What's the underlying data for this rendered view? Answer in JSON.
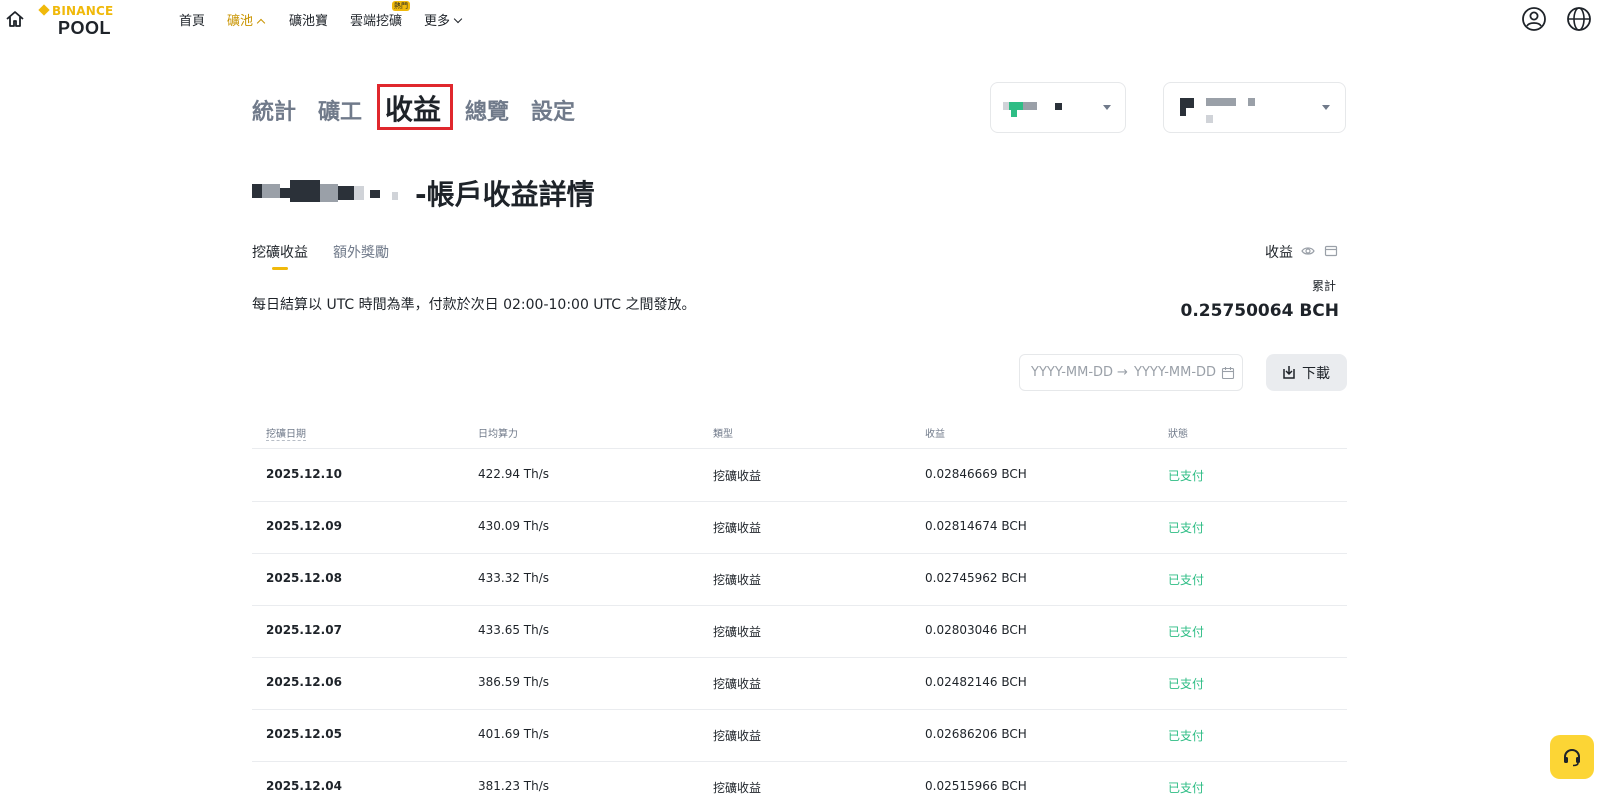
{
  "nav": {
    "logo_top": "BINANCE",
    "logo_bottom": "POOL",
    "items": [
      "首頁",
      "礦池",
      "礦池寶",
      "雲端挖礦",
      "更多"
    ],
    "hot_badge": "熱門"
  },
  "section_tabs": [
    "統計",
    "礦工",
    "收益",
    "總覽",
    "設定"
  ],
  "page_title_suffix": "-帳戶收益詳情",
  "sub_tabs": [
    "挖礦收益",
    "額外獎勵"
  ],
  "earnings": {
    "label": "收益",
    "cumulative_label": "累計",
    "cumulative_value": "0.25750064 BCH"
  },
  "note": "每日結算以 UTC 時間為準，付款於次日 02:00-10:00 UTC 之間發放。",
  "date_range": {
    "start_placeholder": "YYYY-MM-DD",
    "arrow": "→",
    "end_placeholder": "YYYY-MM-DD"
  },
  "download_label": "下載",
  "table": {
    "headers": [
      "挖礦日期",
      "日均算力",
      "類型",
      "收益",
      "狀態"
    ],
    "rows": [
      {
        "date": "2025.12.10",
        "hashrate": "422.94 Th/s",
        "type": "挖礦收益",
        "earnings": "0.02846669 BCH",
        "status": "已支付"
      },
      {
        "date": "2025.12.09",
        "hashrate": "430.09 Th/s",
        "type": "挖礦收益",
        "earnings": "0.02814674 BCH",
        "status": "已支付"
      },
      {
        "date": "2025.12.08",
        "hashrate": "433.32 Th/s",
        "type": "挖礦收益",
        "earnings": "0.02745962 BCH",
        "status": "已支付"
      },
      {
        "date": "2025.12.07",
        "hashrate": "433.65 Th/s",
        "type": "挖礦收益",
        "earnings": "0.02803046 BCH",
        "status": "已支付"
      },
      {
        "date": "2025.12.06",
        "hashrate": "386.59 Th/s",
        "type": "挖礦收益",
        "earnings": "0.02482146 BCH",
        "status": "已支付"
      },
      {
        "date": "2025.12.05",
        "hashrate": "401.69 Th/s",
        "type": "挖礦收益",
        "earnings": "0.02686206 BCH",
        "status": "已支付"
      },
      {
        "date": "2025.12.04",
        "hashrate": "381.23 Th/s",
        "type": "挖礦收益",
        "earnings": "0.02515966 BCH",
        "status": "已支付"
      }
    ]
  },
  "colors": {
    "accent": "#f0b90b",
    "active_nav": "#c99400",
    "paid_status": "#2ebd85",
    "highlight_box": "#e0272d",
    "text_primary": "#1e2329",
    "text_secondary": "#707a8a"
  },
  "icons": [
    "home-icon",
    "user-icon",
    "globe-icon",
    "eye-icon",
    "card-icon",
    "calendar-icon",
    "download-icon",
    "headset-icon"
  ]
}
